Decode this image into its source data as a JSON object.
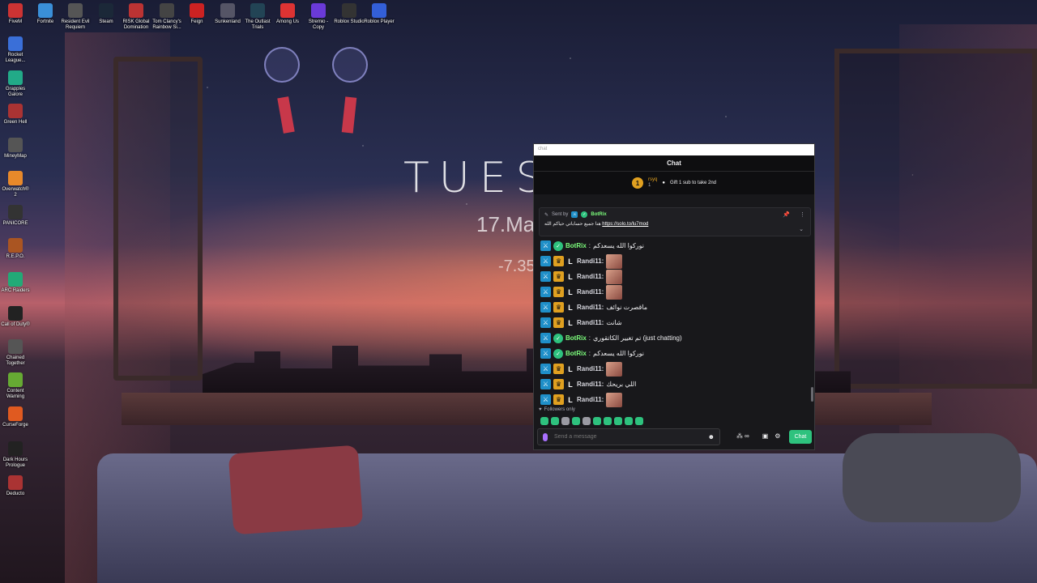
{
  "desktop": {
    "clock_big": "TUES",
    "date": "17.Ma",
    "temp": "-7.35",
    "top_icons": [
      {
        "label": "FiveM",
        "color": "#c33"
      },
      {
        "label": "Fortnite",
        "color": "#3a8fd8"
      },
      {
        "label": "Resident Evil Requiem",
        "color": "#555"
      },
      {
        "label": "Steam",
        "color": "#1b2838"
      },
      {
        "label": "RISK Global Domination",
        "color": "#b33"
      },
      {
        "label": "Tom Clancy's Rainbow Si...",
        "color": "#444"
      },
      {
        "label": "Feign",
        "color": "#c22"
      },
      {
        "label": "Sunkenland",
        "color": "#556"
      },
      {
        "label": "The Outlast Trials",
        "color": "#245"
      },
      {
        "label": "Among Us",
        "color": "#d33"
      },
      {
        "label": "Stremio - Copy",
        "color": "#6a3ad8"
      },
      {
        "label": "Roblox Studio",
        "color": "#333"
      },
      {
        "label": "Roblox Player",
        "color": "#335fd8"
      }
    ],
    "left_icons": [
      {
        "label": "Rocket League...",
        "color": "#3a6fd8"
      },
      {
        "label": "Grapples Galore",
        "color": "#2a8"
      },
      {
        "label": "Green Hell",
        "color": "#a33"
      },
      {
        "label": "MineyMap",
        "color": "#555"
      },
      {
        "label": "Overwatch® 2",
        "color": "#e8892a"
      },
      {
        "label": "PANICORE",
        "color": "#333"
      },
      {
        "label": "R.E.P.O.",
        "color": "#a52"
      },
      {
        "label": "ARC Raiders",
        "color": "#2a7"
      },
      {
        "label": "Call of Duty®",
        "color": "#222"
      },
      {
        "label": "Chained Together",
        "color": "#555"
      },
      {
        "label": "Content Warning",
        "color": "#6a3"
      },
      {
        "label": "CurseForge",
        "color": "#e05a20"
      },
      {
        "label": "Dark Hours Prologue",
        "color": "#222"
      },
      {
        "label": "Deducto",
        "color": "#a33"
      }
    ]
  },
  "chat": {
    "window_title": "chat",
    "header": "Chat",
    "leader": {
      "rank": "1",
      "name": "rsyq",
      "sub": "1",
      "gift_text": "Gift 1 sub to take 2nd"
    },
    "pinned": {
      "sent_by_label": "Sent by",
      "sender": "BotRix",
      "text": "هنا جميع حساباتي حياكم الله",
      "link": "https://solo.to/lu7mod"
    },
    "messages": [
      {
        "user": "BotRix",
        "type": "bot",
        "text": "نوركوا الله يسعدكم"
      },
      {
        "user": "Randi11:",
        "type": "user",
        "text": "",
        "emote": true
      },
      {
        "user": "Randi11:",
        "type": "user",
        "text": "",
        "emote": true
      },
      {
        "user": "Randi11:",
        "type": "user",
        "text": "",
        "emote": true
      },
      {
        "user": "Randi11:",
        "type": "user",
        "text": "ماقصرت نوائف"
      },
      {
        "user": "Randi11:",
        "type": "user",
        "text": "شانت"
      },
      {
        "user": "BotRix",
        "type": "bot",
        "text": "تم تغيير الكاتقوري (just chatting)"
      },
      {
        "user": "BotRix",
        "type": "bot",
        "text": "نوركوا الله يسعدكم"
      },
      {
        "user": "Randi11:",
        "type": "user",
        "text": "",
        "emote": true
      },
      {
        "user": "Randi11:",
        "type": "user",
        "text": "اللي بريحك"
      },
      {
        "user": "Randi11:",
        "type": "user",
        "text": "",
        "emote": true
      }
    ],
    "followers_only": "Followers only",
    "input_placeholder": "Send a message",
    "send_label": "Chat",
    "tool_count": "∞"
  }
}
